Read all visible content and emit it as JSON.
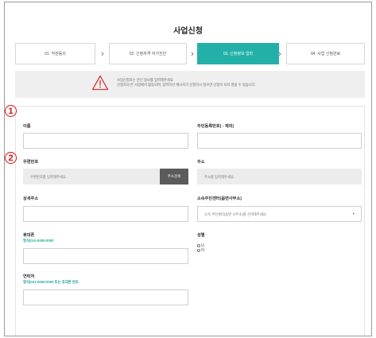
{
  "page": {
    "title": "사업신청"
  },
  "steps": [
    {
      "label": "01. 약관동의",
      "active": false
    },
    {
      "label": "02. 신청자격 자가진단",
      "active": false
    },
    {
      "label": "03. 신청정보 입력",
      "active": true
    },
    {
      "label": "04. 사업 신청완료",
      "active": false
    }
  ],
  "step_separator": "›",
  "notice": {
    "icon": "warning-icon",
    "line1": "사업신청자는 본인 정보를 입력해주세요.",
    "line2": "신청자의 본 사업에서 활동되며, 입력하신 메시지가 신청하시 않으면 신청이 되지 않을 수 있습니다."
  },
  "markers": {
    "first": "1",
    "second": "2"
  },
  "form": {
    "name": {
      "label": "이름"
    },
    "rrn": {
      "label": "주민등록번호( - 제외)"
    },
    "postcode": {
      "label": "우편번호",
      "placeholder": "우편번호를 입력해주세요.",
      "button": "주소검색"
    },
    "address": {
      "label": "주소",
      "placeholder": "주소를 입력해주세요."
    },
    "detail_address": {
      "label": "상세주소"
    },
    "center": {
      "label": "소속주민센터(읍면사무소)",
      "placeholder": "소속 주민센터(읍면 사무소)를 선택해주세요.",
      "caret": "▾"
    },
    "mobile": {
      "label": "휴대폰",
      "hint": "형식(010-0000-0000"
    },
    "gender": {
      "label": "성별",
      "options": [
        "남",
        "여"
      ]
    },
    "contact": {
      "label": "연락처",
      "hint": "형식(031-0000-0000 또는 휴대폰 번호"
    }
  },
  "colors": {
    "accent": "#23b0a8",
    "marker": "#d81010",
    "warning": "#d63a3a"
  }
}
